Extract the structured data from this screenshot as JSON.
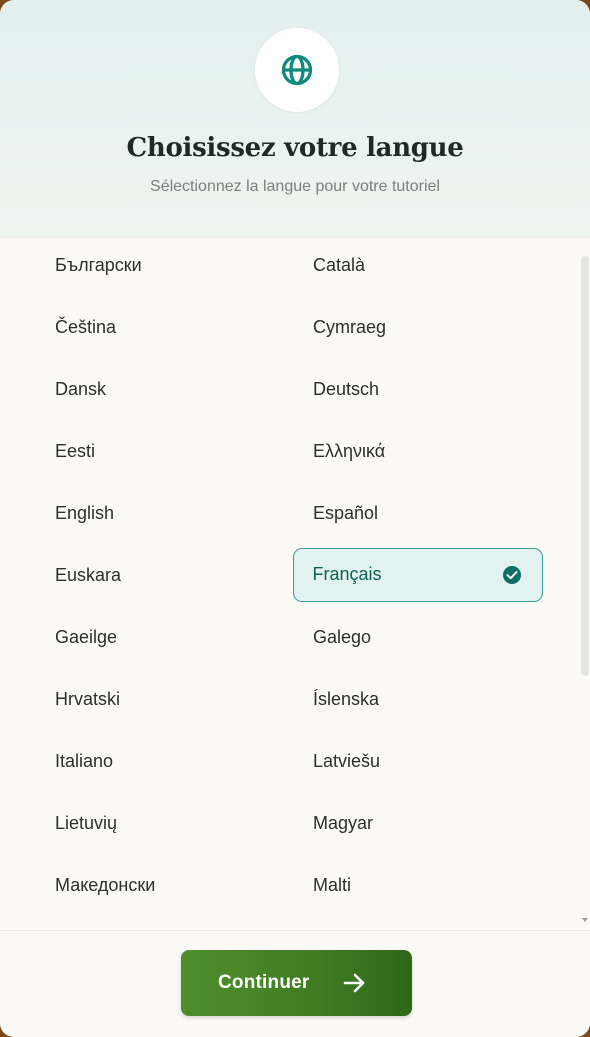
{
  "header": {
    "icon": "globe-icon",
    "title": "Choisissez votre langue",
    "subtitle": "Sélectionnez la langue pour votre tutoriel"
  },
  "languages": [
    "Български",
    "Català",
    "Čeština",
    "Cymraeg",
    "Dansk",
    "Deutsch",
    "Eesti",
    "Ελληνικά",
    "English",
    "Español",
    "Euskara",
    "Français",
    "Gaeilge",
    "Galego",
    "Hrvatski",
    "Íslenska",
    "Italiano",
    "Latviešu",
    "Lietuvių",
    "Magyar",
    "Македонски",
    "Malti"
  ],
  "selected_language": "Français",
  "footer": {
    "continue_label": "Continuer",
    "continue_icon": "arrow-right-icon"
  },
  "colors": {
    "accent": "#3f9d94",
    "button": "#3f7c22",
    "header_bg": "#e3f0ee"
  }
}
